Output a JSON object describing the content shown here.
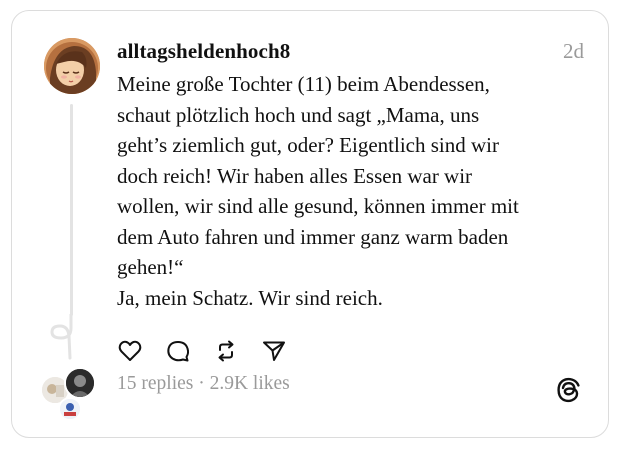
{
  "post": {
    "username": "alltagsheldenhoch8",
    "time_ago": "2d",
    "lines": [
      "Meine große Tochter (11) beim Abendessen,",
      "schaut plötzlich hoch und sagt „Mama, uns",
      "geht’s ziemlich gut, oder? Eigentlich sind wir",
      "doch reich! Wir haben alles Essen war wir",
      "wollen, wir sind alle gesund, können immer mit",
      "dem Auto fahren und immer ganz warm baden",
      "gehen!“",
      "Ja, mein Schatz. Wir sind reich."
    ],
    "stats": "15 replies · 2.9K likes"
  },
  "icons": {
    "like": "heart-icon",
    "reply": "comment-icon",
    "repost": "repost-icon",
    "share": "send-icon",
    "brand": "threads-logo-icon"
  },
  "colors": {
    "text": "#111111",
    "muted": "#9a9a9a",
    "border": "#dcdcdc",
    "thread_line": "#e3e3e3"
  }
}
